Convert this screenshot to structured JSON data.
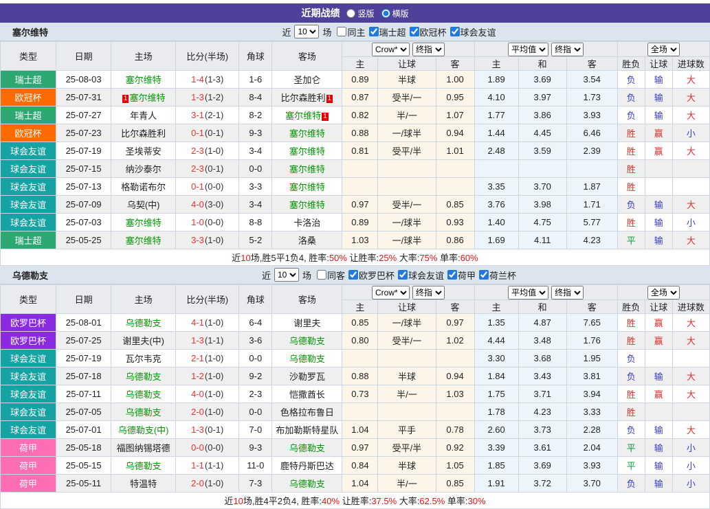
{
  "topbar": {
    "title": "近期战绩",
    "radios": [
      {
        "label": "竖版",
        "checked": false
      },
      {
        "label": "横版",
        "checked": true
      }
    ]
  },
  "colors": {
    "topbar_bg": "#4e4199",
    "section_bg": "#dce4ee",
    "team_green": "#009900",
    "score_red": "#f23030",
    "league": {
      "瑞士超": "#2ea873",
      "欧冠杯": "#ff6a00",
      "球会友谊": "#16a3a3",
      "欧罗巴杯": "#8a2be2",
      "荷甲": "#ff6eb4"
    },
    "result": {
      "red": "#e03131",
      "blue": "#3a3ad0",
      "green": "#0f9d3c"
    }
  },
  "table_header": {
    "left_columns": [
      "类型",
      "日期",
      "主场",
      "比分(半场)",
      "角球",
      "客场"
    ],
    "sub_columns": [
      "主",
      "让球",
      "客",
      "主",
      "和",
      "客",
      "胜负",
      "让球",
      "进球数"
    ],
    "crow_dropdowns": [
      "Crow*",
      "终指"
    ],
    "avg_dropdowns": [
      "平均值",
      "终指"
    ],
    "scope_dropdown": "全场"
  },
  "sections": [
    {
      "team": "塞尔维特",
      "filter": {
        "near_label": "近",
        "count": "10",
        "games_label": "场",
        "checkboxes": [
          {
            "label": "同主",
            "checked": false
          },
          {
            "label": "瑞士超",
            "checked": true
          },
          {
            "label": "欧冠杯",
            "checked": true
          },
          {
            "label": "球会友谊",
            "checked": true
          }
        ]
      },
      "rows": [
        {
          "league": "瑞士超",
          "date": "25-08-03",
          "home": {
            "name": "塞尔维特",
            "green": true
          },
          "ft": "1-4",
          "ht": "(1-3)",
          "corner": "1-6",
          "away": {
            "name": "圣加仑"
          },
          "crow": [
            "0.89",
            "半球",
            "1.00"
          ],
          "avg": [
            "1.89",
            "3.69",
            "3.54"
          ],
          "results": [
            {
              "t": "负",
              "c": "blue"
            },
            {
              "t": "输",
              "c": "blue"
            },
            {
              "t": "大",
              "c": "red"
            }
          ]
        },
        {
          "league": "欧冠杯",
          "date": "25-07-31",
          "home": {
            "name": "塞尔维特",
            "green": true,
            "card_before": "1"
          },
          "ft": "1-3",
          "ht": "(1-2)",
          "corner": "8-4",
          "away": {
            "name": "比尔森胜利",
            "card_after": "1"
          },
          "crow": [
            "0.87",
            "受半/一",
            "0.95"
          ],
          "avg": [
            "4.10",
            "3.97",
            "1.73"
          ],
          "results": [
            {
              "t": "负",
              "c": "blue"
            },
            {
              "t": "输",
              "c": "blue"
            },
            {
              "t": "大",
              "c": "red"
            }
          ]
        },
        {
          "league": "瑞士超",
          "date": "25-07-27",
          "home": {
            "name": "年青人"
          },
          "ft": "3-1",
          "ht": "(2-1)",
          "corner": "8-2",
          "away": {
            "name": "塞尔维特",
            "green": true,
            "card_after": "1"
          },
          "crow": [
            "0.82",
            "半/一",
            "1.07"
          ],
          "avg": [
            "1.77",
            "3.86",
            "3.93"
          ],
          "results": [
            {
              "t": "负",
              "c": "blue"
            },
            {
              "t": "输",
              "c": "blue"
            },
            {
              "t": "大",
              "c": "red"
            }
          ]
        },
        {
          "league": "欧冠杯",
          "date": "25-07-23",
          "home": {
            "name": "比尔森胜利"
          },
          "ft": "0-1",
          "ht": "(0-1)",
          "corner": "9-3",
          "away": {
            "name": "塞尔维特",
            "green": true
          },
          "crow": [
            "0.88",
            "一/球半",
            "0.94"
          ],
          "avg": [
            "1.44",
            "4.45",
            "6.46"
          ],
          "results": [
            {
              "t": "胜",
              "c": "red"
            },
            {
              "t": "赢",
              "c": "red"
            },
            {
              "t": "小",
              "c": "blue"
            }
          ]
        },
        {
          "league": "球会友谊",
          "date": "25-07-19",
          "home": {
            "name": "圣埃蒂安"
          },
          "ft": "2-3",
          "ht": "(1-0)",
          "corner": "3-4",
          "away": {
            "name": "塞尔维特",
            "green": true
          },
          "crow": [
            "0.81",
            "受平/半",
            "1.01"
          ],
          "avg": [
            "2.48",
            "3.59",
            "2.39"
          ],
          "results": [
            {
              "t": "胜",
              "c": "red"
            },
            {
              "t": "赢",
              "c": "red"
            },
            {
              "t": "大",
              "c": "red"
            }
          ]
        },
        {
          "league": "球会友谊",
          "date": "25-07-15",
          "home": {
            "name": "纳沙泰尔"
          },
          "ft": "2-3",
          "ht": "(0-1)",
          "corner": "0-0",
          "away": {
            "name": "塞尔维特",
            "green": true
          },
          "crow": [
            "",
            "",
            ""
          ],
          "avg": [
            "",
            "",
            ""
          ],
          "results": [
            {
              "t": "胜",
              "c": "red"
            },
            {
              "t": ""
            },
            {
              "t": ""
            }
          ]
        },
        {
          "league": "球会友谊",
          "date": "25-07-13",
          "home": {
            "name": "格勒诺布尔"
          },
          "ft": "0-1",
          "ht": "(0-0)",
          "corner": "3-3",
          "away": {
            "name": "塞尔维特",
            "green": true
          },
          "crow": [
            "",
            "",
            ""
          ],
          "avg": [
            "3.35",
            "3.70",
            "1.87"
          ],
          "results": [
            {
              "t": "胜",
              "c": "red"
            },
            {
              "t": ""
            },
            {
              "t": ""
            }
          ]
        },
        {
          "league": "球会友谊",
          "date": "25-07-09",
          "home": {
            "name": "乌契(中)"
          },
          "ft": "4-0",
          "ht": "(3-0)",
          "corner": "3-4",
          "away": {
            "name": "塞尔维特",
            "green": true
          },
          "crow": [
            "0.97",
            "受半/一",
            "0.85"
          ],
          "avg": [
            "3.76",
            "3.98",
            "1.71"
          ],
          "results": [
            {
              "t": "负",
              "c": "blue"
            },
            {
              "t": "输",
              "c": "blue"
            },
            {
              "t": "大",
              "c": "red"
            }
          ]
        },
        {
          "league": "球会友谊",
          "date": "25-07-03",
          "home": {
            "name": "塞尔维特",
            "green": true
          },
          "ft": "1-0",
          "ht": "(0-0)",
          "corner": "8-8",
          "away": {
            "name": "卡洛治"
          },
          "crow": [
            "0.89",
            "一/球半",
            "0.93"
          ],
          "avg": [
            "1.40",
            "4.75",
            "5.77"
          ],
          "results": [
            {
              "t": "胜",
              "c": "red"
            },
            {
              "t": "输",
              "c": "blue"
            },
            {
              "t": "小",
              "c": "blue"
            }
          ]
        },
        {
          "league": "瑞士超",
          "date": "25-05-25",
          "home": {
            "name": "塞尔维特",
            "green": true
          },
          "ft": "3-3",
          "ht": "(1-0)",
          "corner": "5-2",
          "away": {
            "name": "洛桑"
          },
          "crow": [
            "1.03",
            "一/球半",
            "0.86"
          ],
          "avg": [
            "1.69",
            "4.11",
            "4.23"
          ],
          "results": [
            {
              "t": "平",
              "c": "green"
            },
            {
              "t": "输",
              "c": "blue"
            },
            {
              "t": "大",
              "c": "red"
            }
          ]
        }
      ],
      "summary": [
        {
          "t": "近"
        },
        {
          "t": "10",
          "red": true
        },
        {
          "t": "场,胜5平1负4, 胜率:"
        },
        {
          "t": "50%",
          "red": true
        },
        {
          "t": " 让胜率:"
        },
        {
          "t": "25%",
          "red": true
        },
        {
          "t": " 大率:"
        },
        {
          "t": "75%",
          "red": true
        },
        {
          "t": " 单率:"
        },
        {
          "t": "60%",
          "red": true
        }
      ]
    },
    {
      "team": "乌德勒支",
      "filter": {
        "near_label": "近",
        "count": "10",
        "games_label": "场",
        "checkboxes": [
          {
            "label": "同客",
            "checked": false
          },
          {
            "label": "欧罗巴杯",
            "checked": true
          },
          {
            "label": "球会友谊",
            "checked": true
          },
          {
            "label": "荷甲",
            "checked": true
          },
          {
            "label": "荷兰杯",
            "checked": true
          }
        ]
      },
      "rows": [
        {
          "league": "欧罗巴杯",
          "date": "25-08-01",
          "home": {
            "name": "乌德勒支",
            "green": true
          },
          "ft": "4-1",
          "ht": "(1-0)",
          "corner": "6-4",
          "away": {
            "name": "谢里夫"
          },
          "crow": [
            "0.85",
            "一/球半",
            "0.97"
          ],
          "avg": [
            "1.35",
            "4.87",
            "7.65"
          ],
          "results": [
            {
              "t": "胜",
              "c": "red"
            },
            {
              "t": "赢",
              "c": "red"
            },
            {
              "t": "大",
              "c": "red"
            }
          ]
        },
        {
          "league": "欧罗巴杯",
          "date": "25-07-25",
          "home": {
            "name": "谢里夫(中)"
          },
          "ft": "1-3",
          "ht": "(1-1)",
          "corner": "3-6",
          "away": {
            "name": "乌德勒支",
            "green": true
          },
          "crow": [
            "0.80",
            "受半/一",
            "1.02"
          ],
          "avg": [
            "4.44",
            "3.48",
            "1.76"
          ],
          "results": [
            {
              "t": "胜",
              "c": "red"
            },
            {
              "t": "赢",
              "c": "red"
            },
            {
              "t": "大",
              "c": "red"
            }
          ]
        },
        {
          "league": "球会友谊",
          "date": "25-07-19",
          "home": {
            "name": "瓦尔韦克"
          },
          "ft": "2-1",
          "ht": "(1-0)",
          "corner": "0-0",
          "away": {
            "name": "乌德勒支",
            "green": true
          },
          "crow": [
            "",
            "",
            ""
          ],
          "avg": [
            "3.30",
            "3.68",
            "1.95"
          ],
          "results": [
            {
              "t": "负",
              "c": "blue"
            },
            {
              "t": ""
            },
            {
              "t": ""
            }
          ]
        },
        {
          "league": "球会友谊",
          "date": "25-07-18",
          "home": {
            "name": "乌德勒支",
            "green": true
          },
          "ft": "1-2",
          "ht": "(1-0)",
          "corner": "9-2",
          "away": {
            "name": "沙勒罗瓦"
          },
          "crow": [
            "0.88",
            "半球",
            "0.94"
          ],
          "avg": [
            "1.84",
            "3.43",
            "3.81"
          ],
          "results": [
            {
              "t": "负",
              "c": "blue"
            },
            {
              "t": "输",
              "c": "blue"
            },
            {
              "t": "大",
              "c": "red"
            }
          ]
        },
        {
          "league": "球会友谊",
          "date": "25-07-11",
          "home": {
            "name": "乌德勒支",
            "green": true
          },
          "ft": "4-0",
          "ht": "(1-0)",
          "corner": "2-3",
          "away": {
            "name": "恺撒酋长"
          },
          "crow": [
            "0.73",
            "半/一",
            "1.03"
          ],
          "avg": [
            "1.75",
            "3.71",
            "3.94"
          ],
          "results": [
            {
              "t": "胜",
              "c": "red"
            },
            {
              "t": "赢",
              "c": "red"
            },
            {
              "t": "大",
              "c": "red"
            }
          ]
        },
        {
          "league": "球会友谊",
          "date": "25-07-05",
          "home": {
            "name": "乌德勒支",
            "green": true
          },
          "ft": "2-0",
          "ht": "(1-0)",
          "corner": "0-0",
          "away": {
            "name": "色格拉布鲁日"
          },
          "crow": [
            "",
            "",
            ""
          ],
          "avg": [
            "1.78",
            "4.23",
            "3.33"
          ],
          "results": [
            {
              "t": "胜",
              "c": "red"
            },
            {
              "t": ""
            },
            {
              "t": ""
            }
          ]
        },
        {
          "league": "球会友谊",
          "date": "25-07-01",
          "home": {
            "name": "乌德勒支(中)",
            "green": true
          },
          "ft": "1-3",
          "ht": "(0-1)",
          "corner": "7-0",
          "away": {
            "name": "布加勒斯特星队"
          },
          "crow": [
            "1.04",
            "平手",
            "0.78"
          ],
          "avg": [
            "2.60",
            "3.73",
            "2.28"
          ],
          "results": [
            {
              "t": "负",
              "c": "blue"
            },
            {
              "t": "输",
              "c": "blue"
            },
            {
              "t": "大",
              "c": "red"
            }
          ]
        },
        {
          "league": "荷甲",
          "date": "25-05-18",
          "home": {
            "name": "福图纳锡塔德"
          },
          "ft": "0-0",
          "ht": "(0-0)",
          "corner": "9-3",
          "away": {
            "name": "乌德勒支",
            "green": true
          },
          "crow": [
            "0.97",
            "受平/半",
            "0.92"
          ],
          "avg": [
            "3.39",
            "3.61",
            "2.04"
          ],
          "results": [
            {
              "t": "平",
              "c": "green"
            },
            {
              "t": "输",
              "c": "blue"
            },
            {
              "t": "小",
              "c": "blue"
            }
          ]
        },
        {
          "league": "荷甲",
          "date": "25-05-15",
          "home": {
            "name": "乌德勒支",
            "green": true
          },
          "ft": "1-1",
          "ht": "(1-1)",
          "corner": "11-0",
          "away": {
            "name": "鹿特丹斯巴达"
          },
          "crow": [
            "0.84",
            "半球",
            "1.05"
          ],
          "avg": [
            "1.85",
            "3.69",
            "3.93"
          ],
          "results": [
            {
              "t": "平",
              "c": "green"
            },
            {
              "t": "输",
              "c": "blue"
            },
            {
              "t": "小",
              "c": "blue"
            }
          ]
        },
        {
          "league": "荷甲",
          "date": "25-05-11",
          "home": {
            "name": "特温特"
          },
          "ft": "2-0",
          "ht": "(1-0)",
          "corner": "7-3",
          "away": {
            "name": "乌德勒支",
            "green": true
          },
          "crow": [
            "1.04",
            "半/一",
            "0.85"
          ],
          "avg": [
            "1.91",
            "3.72",
            "3.70"
          ],
          "results": [
            {
              "t": "负",
              "c": "blue"
            },
            {
              "t": "输",
              "c": "blue"
            },
            {
              "t": "小",
              "c": "blue"
            }
          ]
        }
      ],
      "summary": [
        {
          "t": "近"
        },
        {
          "t": "10",
          "red": true
        },
        {
          "t": "场,胜4平2负4, 胜率:"
        },
        {
          "t": "40%",
          "red": true
        },
        {
          "t": " 让胜率:"
        },
        {
          "t": "37.5%",
          "red": true
        },
        {
          "t": " 大率:"
        },
        {
          "t": "62.5%",
          "red": true
        },
        {
          "t": " 单率:"
        },
        {
          "t": "30%",
          "red": true
        }
      ]
    }
  ]
}
